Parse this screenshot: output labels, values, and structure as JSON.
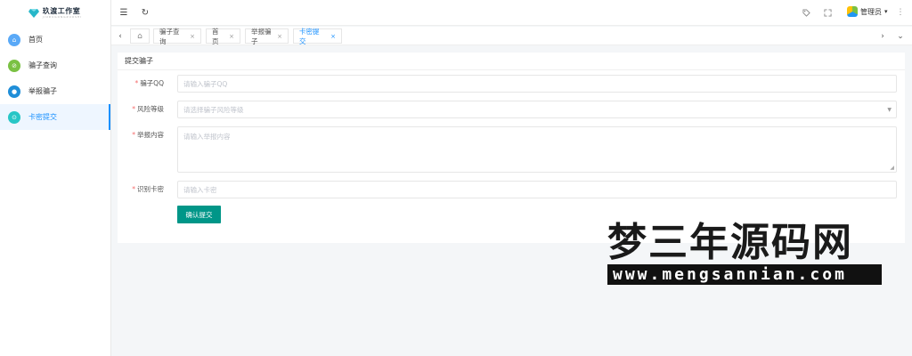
{
  "app": {
    "logo_title": "玖渡工作室",
    "logo_subtitle": "JIUDUGONGZUOSHI"
  },
  "sidebar": {
    "items": [
      {
        "label": "首页",
        "icon": "home-icon",
        "color": "#5aa9f7",
        "glyph": "⌂",
        "active": false
      },
      {
        "label": "骗子查询",
        "icon": "search-icon",
        "color": "#7ac143",
        "glyph": "⊘",
        "active": false
      },
      {
        "label": "举报骗子",
        "icon": "report-icon",
        "color": "#1f8ed8",
        "glyph": "●",
        "active": false
      },
      {
        "label": "卡密提交",
        "icon": "card-icon",
        "color": "#27c6c6",
        "glyph": "⊙",
        "active": true
      }
    ]
  },
  "header": {
    "menu_icon": "☰",
    "refresh_icon": "↻",
    "user_name": "管理员"
  },
  "tabs": [
    {
      "label": "骗子查询"
    },
    {
      "label": "首页"
    },
    {
      "label": "举报骗子"
    },
    {
      "label": "卡密提交"
    }
  ],
  "form": {
    "title": "提交骗子",
    "qq_label": "骗子QQ",
    "qq_placeholder": "请输入骗子QQ",
    "risk_label": "风险等级",
    "risk_placeholder": "请选择骗子风险等级",
    "content_label": "举报内容",
    "content_placeholder": "请输入举报内容",
    "card_label": "识别卡密",
    "card_placeholder": "请输入卡密",
    "submit_label": "确认提交"
  },
  "watermark": {
    "title": "梦三年源码网",
    "url": "www.mengsannian.com"
  },
  "colors": {
    "accent": "#1890ff",
    "button": "#009688",
    "required": "#f56c6c"
  }
}
